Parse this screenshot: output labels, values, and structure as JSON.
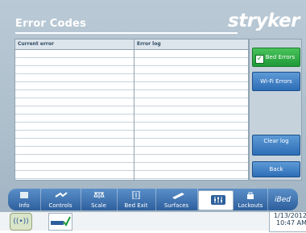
{
  "header": {
    "title": "Error Codes",
    "brand": "stryker"
  },
  "table": {
    "col1": "Current error",
    "col2": "Error log",
    "rows": 16
  },
  "panel": {
    "bed_errors": "Bed Errors",
    "wifi_errors": "Wi-Fi Errors",
    "clear_log": "Clear log",
    "back": "Back"
  },
  "nav": {
    "info": "Info",
    "controls": "Controls",
    "scale": "Scale",
    "bed_exit": "Bed Exit",
    "surfaces": "Surfaces",
    "lockouts": "Lockouts",
    "ibed": "iBed"
  },
  "status": {
    "date": "1/13/2012",
    "time": "10:47 AM"
  },
  "colors": {
    "accent": "#2d6db6",
    "bed_errors_btn": "#1f9a38"
  },
  "icons": {
    "info": "info-bed-icon",
    "controls": "controls-bed-icon",
    "scale": "scale-icon",
    "bed_exit": "bed-exit-icon",
    "surfaces": "surfaces-icon",
    "settings": "settings-sliders-icon",
    "lockouts": "lock-icon",
    "wifi": "wifi-icon",
    "bed_check": "bed-check-icon"
  }
}
